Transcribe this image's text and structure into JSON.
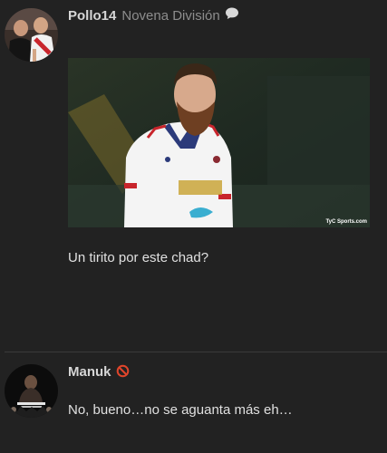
{
  "posts": [
    {
      "username": "Pollo14",
      "user_title": "Novena División",
      "status_icon": "speech-bubble-icon",
      "image": {
        "credit": "TyC Sports.com"
      },
      "text": "Un tirito por este chad?"
    },
    {
      "username": "Manuk",
      "status_icon": "blocked-icon",
      "text": "No, bueno…no se aguanta más eh…"
    }
  ],
  "colors": {
    "background": "#222222",
    "username": "#d6d6d6",
    "user_title": "#8d8d8d",
    "text": "#e0e0e0",
    "divider": "#3a3a3a",
    "blocked": "#e0452b"
  }
}
